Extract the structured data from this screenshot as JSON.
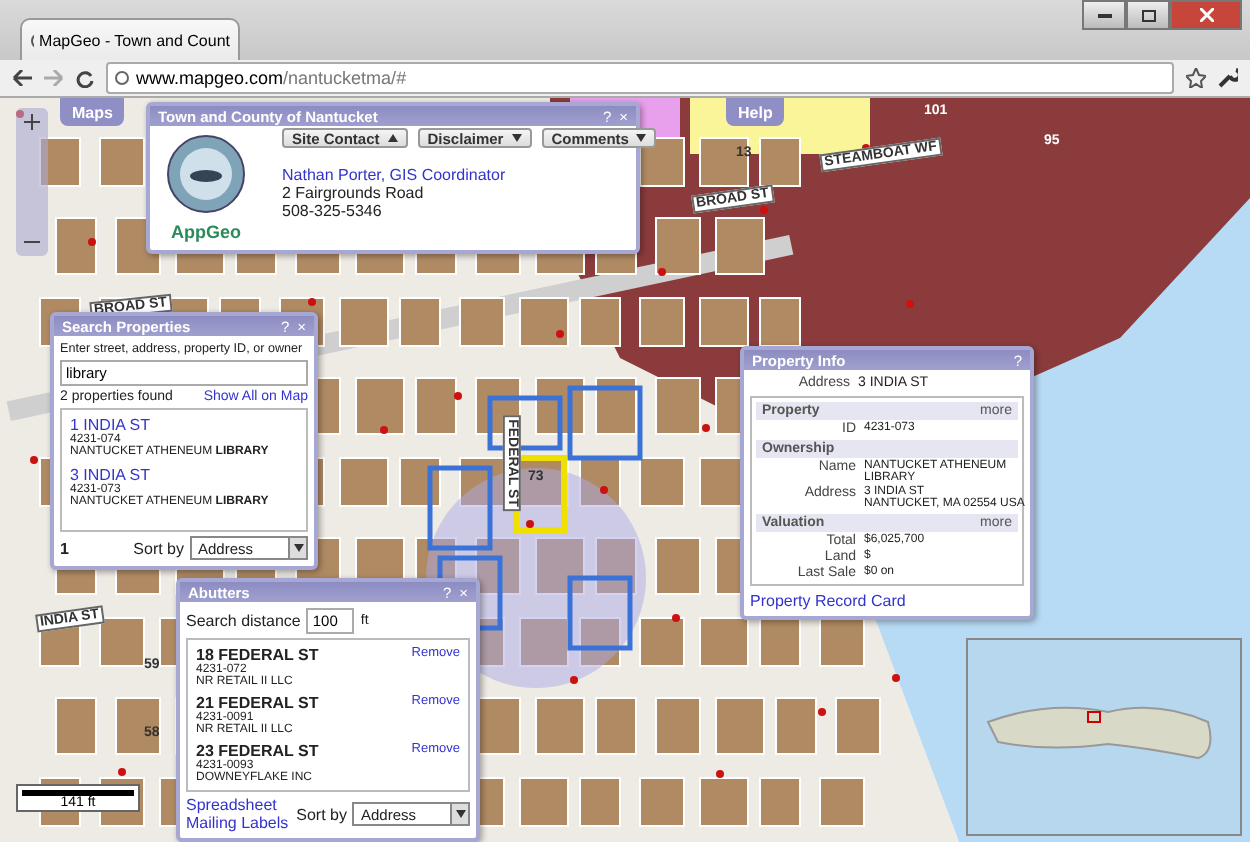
{
  "browser": {
    "tab_title": "MapGeo - Town and Count",
    "url_domain": "www.mapgeo.com",
    "url_path": "/nantucketma/#"
  },
  "map": {
    "labels": [
      "101",
      "95",
      "13",
      "BROAD ST",
      "STEAMBOAT WF",
      "BROAD ST",
      "FEDERAL ST",
      "INDIA ST",
      "73",
      "59",
      "58"
    ],
    "scale": "141 ft"
  },
  "map_buttons": [
    {
      "label": "Maps"
    },
    {
      "label": "Help"
    }
  ],
  "site_panel": {
    "title": "Town and County of Nantucket",
    "controls": [
      "?",
      "×"
    ],
    "menus": [
      {
        "label": "Site Contact",
        "expanded": true
      },
      {
        "label": "Disclaimer",
        "expanded": false
      },
      {
        "label": "Comments",
        "expanded": false
      }
    ],
    "contact_name": "Nathan Porter, GIS Coordinator",
    "address": "2 Fairgrounds Road",
    "phone": "508-325-5346",
    "logo_text": "AppGeo"
  },
  "search_panel": {
    "title": "Search Properties",
    "controls": [
      "?",
      "×"
    ],
    "prompt": "Enter street, address, property ID, or owner",
    "query": "library",
    "count": "2 properties found",
    "show_all": "Show All on Map",
    "results": [
      {
        "address": "1 INDIA ST",
        "id": "4231-074",
        "owner": "NANTUCKET ATHENEUM **LIBRARY**"
      },
      {
        "address": "3 INDIA ST",
        "id": "4231-073",
        "owner": "NANTUCKET ATHENEUM **LIBRARY**"
      }
    ],
    "page": "1",
    "sort_label": "Sort by",
    "sort_value": "Address"
  },
  "property_info": {
    "title": "Property Info",
    "controls": [
      "?"
    ],
    "address_label": "Address",
    "address": "3 INDIA ST",
    "sections": [
      {
        "title": "Property",
        "more": "more",
        "fields": [
          {
            "label": "ID",
            "lines": [
              "4231-073"
            ]
          }
        ]
      },
      {
        "title": "Ownership",
        "fields": [
          {
            "label": "Name",
            "lines": [
              "NANTUCKET ATHENEUM",
              "LIBRARY"
            ]
          },
          {
            "label": "Address",
            "lines": [
              "3 INDIA ST",
              "NANTUCKET, MA 02554 USA"
            ]
          }
        ]
      },
      {
        "title": "Valuation",
        "more": "more",
        "fields": [
          {
            "label": "Total",
            "lines": [
              "$6,025,700"
            ]
          },
          {
            "label": "Land",
            "lines": [
              "$"
            ]
          },
          {
            "label": "Last Sale",
            "lines": [
              "$0 on"
            ]
          }
        ]
      }
    ],
    "record_link": "Property Record Card"
  },
  "abutters": {
    "title": "Abutters",
    "controls": [
      "?",
      "×"
    ],
    "distance_label": "Search distance",
    "distance": "100",
    "unit": "ft",
    "items": [
      {
        "address": "18 FEDERAL ST",
        "id": "4231-072",
        "owner": "NR RETAIL II LLC",
        "action": "Remove"
      },
      {
        "address": "21 FEDERAL ST",
        "id": "4231-0091",
        "owner": "NR RETAIL II LLC",
        "action": "Remove"
      },
      {
        "address": "23 FEDERAL ST",
        "id": "4231-0093",
        "owner": "DOWNEYFLAKE INC",
        "action": "Remove"
      }
    ],
    "links": [
      "Spreadsheet",
      "Mailing Labels"
    ],
    "sort_label": "Sort by",
    "sort_value": "Address"
  }
}
